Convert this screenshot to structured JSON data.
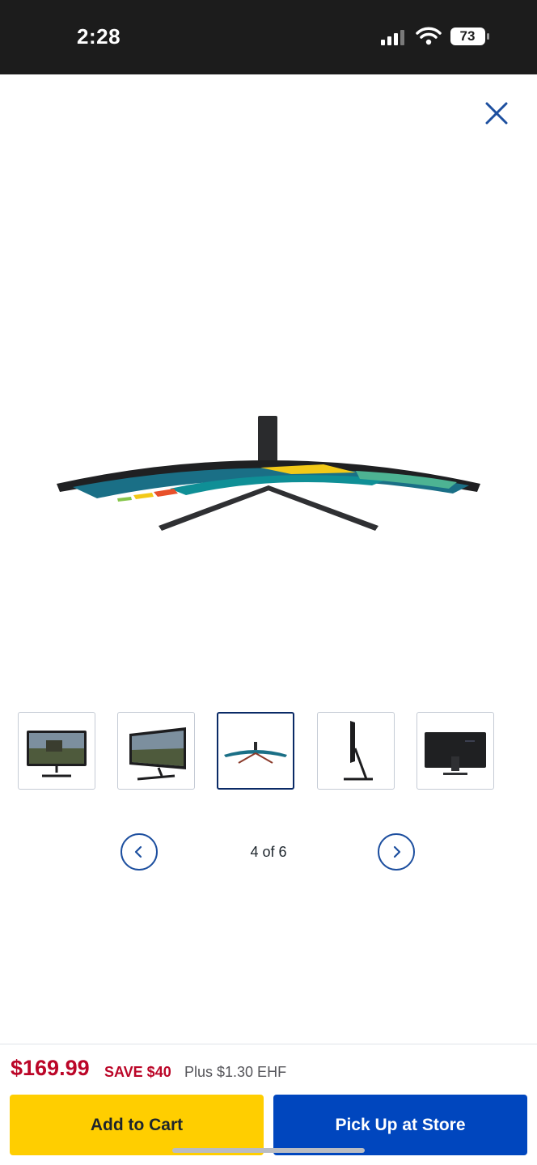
{
  "status_bar": {
    "time": "2:28",
    "battery_level": "73"
  },
  "viewer": {
    "close_icon": "close-icon",
    "counter_text": "4 of 6",
    "current_index": 4,
    "total_images": 6,
    "prev_icon": "chevron-left-icon",
    "next_icon": "chevron-right-icon"
  },
  "thumbnails": [
    {
      "name": "front-view",
      "selected": false
    },
    {
      "name": "angled-view",
      "selected": false
    },
    {
      "name": "top-view",
      "selected": true
    },
    {
      "name": "side-view",
      "selected": false
    },
    {
      "name": "back-view",
      "selected": false
    }
  ],
  "purchase_bar": {
    "price": "$169.99",
    "savings": "SAVE $40",
    "fee_note": "Plus $1.30 EHF",
    "add_to_cart_label": "Add to Cart",
    "pickup_label": "Pick Up at Store"
  },
  "colors": {
    "accent_blue": "#0046be",
    "cart_yellow": "#ffce00",
    "price_red": "#bb0628",
    "nav_blue": "#1d4f9f",
    "selected_border": "#0a2a66"
  }
}
